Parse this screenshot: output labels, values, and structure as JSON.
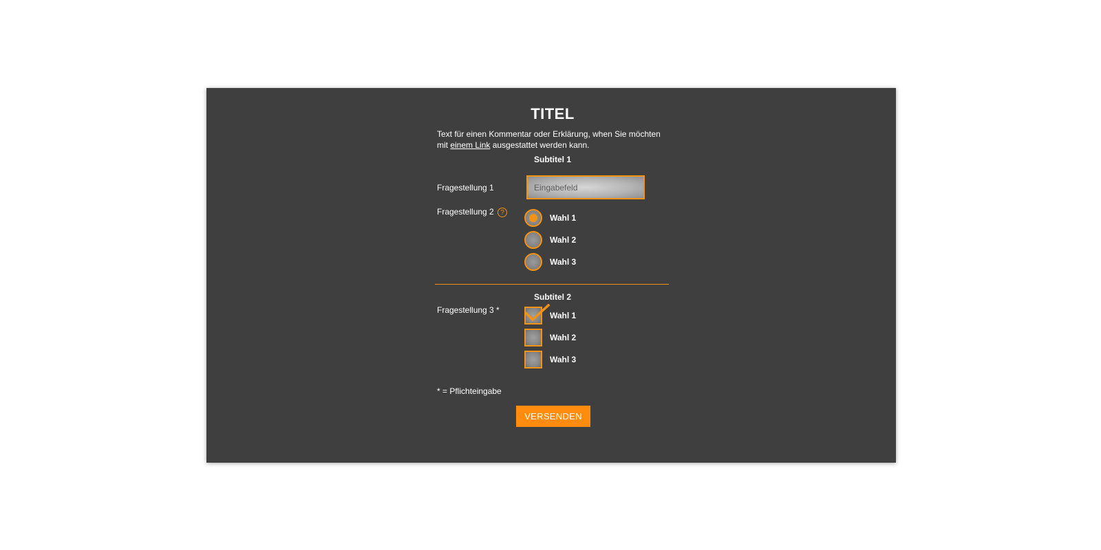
{
  "form": {
    "title": "TITEL",
    "intro_before_link": "Text für einen Kommentar oder Erklärung, when Sie möchten mit ",
    "intro_link": "einem Link",
    "intro_after_link": " ausgestattet werden kann.",
    "section1": {
      "subtitle": "Subtitel 1",
      "question1": {
        "label": "Fragestellung 1",
        "placeholder": "Eingabefeld",
        "value": ""
      },
      "question2": {
        "label": "Fragestellung 2",
        "help_icon": "question-mark-circle-icon",
        "help_text": "?",
        "options": [
          {
            "label": "Wahl 1",
            "checked": true
          },
          {
            "label": "Wahl 2",
            "checked": false
          },
          {
            "label": "Wahl 3",
            "checked": false
          }
        ]
      }
    },
    "section2": {
      "subtitle": "Subtitel 2",
      "question3": {
        "label": "Fragestellung 3 *",
        "options": [
          {
            "label": "Wahl 1",
            "checked": true
          },
          {
            "label": "Wahl 2",
            "checked": false
          },
          {
            "label": "Wahl 3",
            "checked": false
          }
        ]
      }
    },
    "footnote": "* = Pflichteingabe",
    "submit_label": "VERSENDEN"
  },
  "colors": {
    "panel_background": "#3f3f3f",
    "accent": "#f39214",
    "button": "#ff8c0f",
    "text": "#ffffff"
  }
}
